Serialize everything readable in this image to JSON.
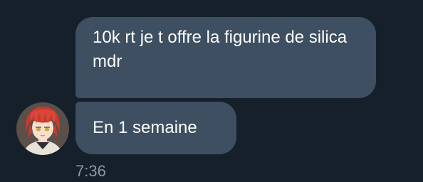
{
  "messages": [
    {
      "text": "10k rt je t offre la figurine de silica mdr"
    },
    {
      "text": "En 1 semaine"
    }
  ],
  "timestamp": "7:36",
  "avatar": {
    "icon": "anime-character-avatar-icon"
  },
  "colors": {
    "background": "#16202b",
    "bubble": "#3d4f60",
    "text": "#ffffff",
    "timestamp": "#8899a6"
  }
}
